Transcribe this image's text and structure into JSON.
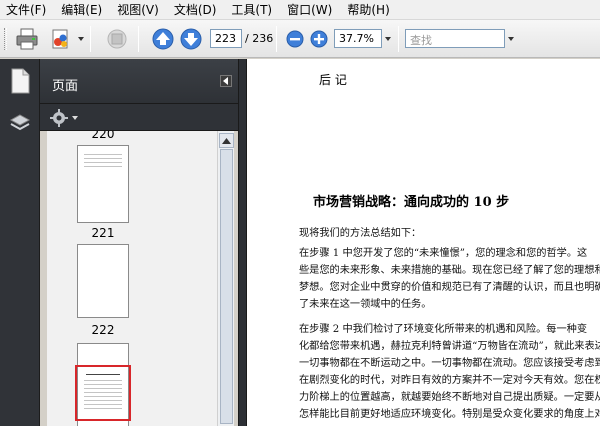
{
  "menu": [
    "文件(F)",
    "编辑(E)",
    "视图(V)",
    "文档(D)",
    "工具(T)",
    "窗口(W)",
    "帮助(H)"
  ],
  "toolbar": {
    "page_current": "223",
    "page_total": "/ 236",
    "zoom": "37.7%",
    "find_placeholder": "查找",
    "icons": [
      "print-icon",
      "share-icon",
      "collaborate-icon",
      "prev-page-icon",
      "next-page-icon",
      "zoom-out-icon",
      "zoom-in-icon"
    ]
  },
  "nav_panel": {
    "title": "页面",
    "thumbnails": [
      {
        "label": "220"
      },
      {
        "label": "221"
      },
      {
        "label": "222"
      }
    ]
  },
  "document": {
    "header_mark": "后 记",
    "title": "市场营销战略：通向成功的 10 步",
    "paragraphs": [
      "    现将我们的方法总结如下：",
      "    在步骤 1 中您开发了您的“未来憧憬”，您的理念和您的哲学。这",
      "些是您的未来形象、未来措施的基础。现在您已经了解了您的理想和",
      "梦想。您对企业中贯穿的价值和规范已有了清醒的认识，而且也明确",
      "了未来在这一领域中的任务。",
      "    在步骤 2 中我们检讨了环境变化所带来的机遇和风险。每一种变",
      "化都给您带来机遇，赫拉克利特曾讲道“万物皆在流动”，就此来表达",
      "一切事物都在不断运动之中。一切事物都在流动。您应该接受考虑到，",
      "在剧烈变化的时代，对昨日有效的方案并不一定对今天有效。您在权",
      "力阶梯上的位置越高，就越要始终不断地对自己提出质疑。一定要从",
      "怎样能比目前更好地适应环境变化。特别是受众变化要求的角度上对"
    ]
  }
}
